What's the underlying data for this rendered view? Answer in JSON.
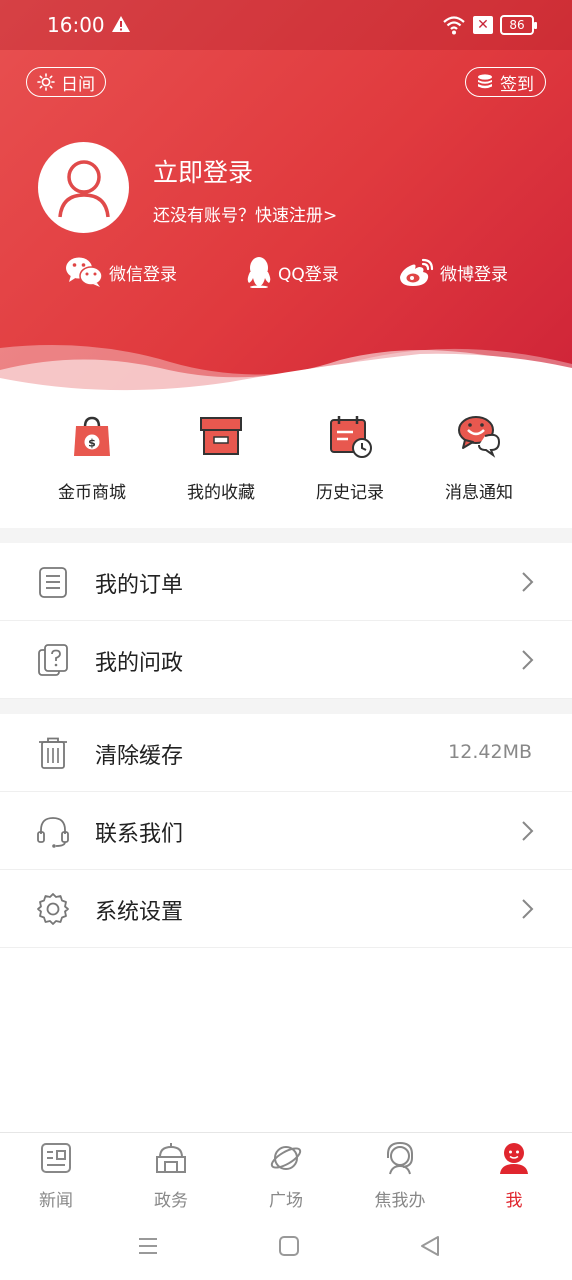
{
  "status_bar": {
    "time": "16:00",
    "sim_badge": "✕",
    "battery": "86"
  },
  "header": {
    "day_mode_label": "日间",
    "sign_in_label": "签到",
    "login_title": "立即登录",
    "login_subtitle": "还没有账号？快速注册>",
    "social": [
      {
        "label": "微信登录",
        "icon": "wechat-icon"
      },
      {
        "label": "QQ登录",
        "icon": "qq-icon"
      },
      {
        "label": "微博登录",
        "icon": "weibo-icon"
      }
    ]
  },
  "quick_actions": [
    {
      "label": "金币商城",
      "icon": "coin-bag-icon"
    },
    {
      "label": "我的收藏",
      "icon": "box-icon"
    },
    {
      "label": "历史记录",
      "icon": "calendar-clock-icon"
    },
    {
      "label": "消息通知",
      "icon": "chat-bubbles-icon"
    }
  ],
  "menu_group_1": [
    {
      "label": "我的订单",
      "icon": "order-list-icon"
    },
    {
      "label": "我的问政",
      "icon": "question-doc-icon"
    }
  ],
  "menu_group_2": [
    {
      "label": "清除缓存",
      "icon": "trash-icon",
      "value": "12.42MB"
    },
    {
      "label": "联系我们",
      "icon": "headset-icon"
    },
    {
      "label": "系统设置",
      "icon": "gear-icon"
    }
  ],
  "tabs": [
    {
      "label": "新闻",
      "icon": "news-icon"
    },
    {
      "label": "政务",
      "icon": "government-icon"
    },
    {
      "label": "广场",
      "icon": "planet-icon"
    },
    {
      "label": "焦我办",
      "icon": "service-agent-icon"
    },
    {
      "label": "我",
      "icon": "profile-icon",
      "active": true
    }
  ],
  "colors": {
    "brand_red": "#e03a3e",
    "active_tab": "#e0262e",
    "text": "#222222",
    "muted": "#888888"
  }
}
